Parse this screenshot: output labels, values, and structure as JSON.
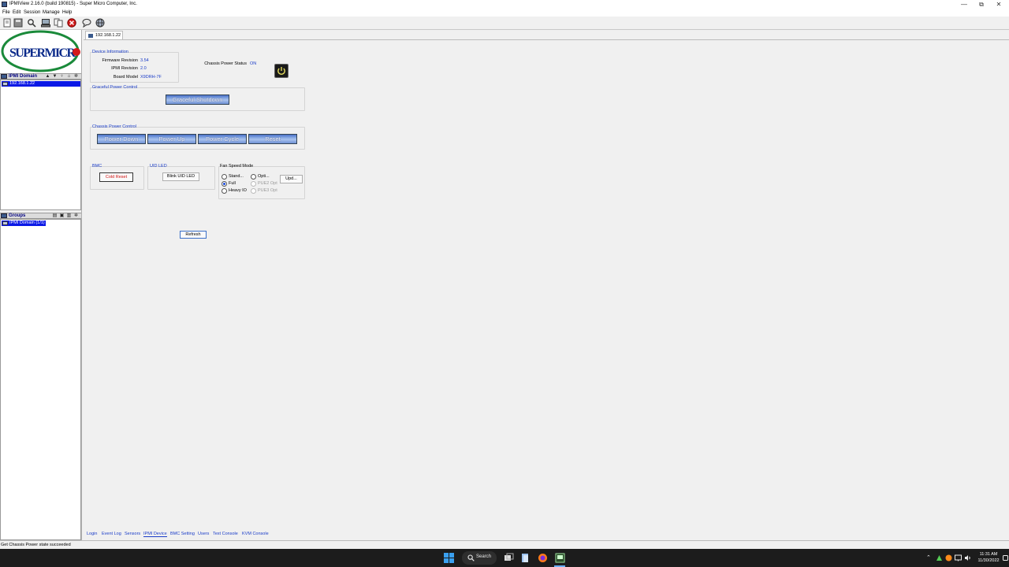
{
  "window": {
    "title": "IPMIView 2.16.0 (build 190815) - Super Micro Computer, Inc.",
    "minimize": "—",
    "maximize": "⧉",
    "close": "✕"
  },
  "menu": [
    "File",
    "Edit",
    "Session",
    "Manage",
    "Help"
  ],
  "toolbar_icons": [
    "new-icon",
    "save-icon",
    "search-icon",
    "computer-icon",
    "copy-icon",
    "disconnect-icon",
    "chat-icon",
    "globe-icon"
  ],
  "sidebar": {
    "logo_text": "SUPERMICR",
    "ipmi_header": "IPMI Domain",
    "ipmi_items": [
      "192.168.1.22"
    ],
    "groups_header": "Groups",
    "group_items": [
      "IPMI Domain (1/1)"
    ]
  },
  "tab": {
    "label": "192.168.1.22"
  },
  "device_info": {
    "title": "Device Information",
    "firmware_label": "Firmware Revision",
    "firmware_value": "3.54",
    "ipmi_label": "IPMI Revision",
    "ipmi_value": "2.0",
    "board_label": "Board Model",
    "board_value": "X9DRH-7F"
  },
  "chassis_status": {
    "label": "Chassis Power Status",
    "value": "ON"
  },
  "graceful": {
    "title": "Graceful Power Control",
    "shutdown_label": "Graceful Shutdown"
  },
  "chassis_control": {
    "title": "Chassis Power Control",
    "buttons": [
      "Power Down",
      "Power Up",
      "Power Cycle",
      "Reset"
    ]
  },
  "bmc": {
    "title": "BMC",
    "cold_reset_label": "Cold Reset"
  },
  "uid_led": {
    "title": "UID LED",
    "blink_label": "Blink UID LED"
  },
  "fan": {
    "title": "Fan Speed Mode",
    "standard": "Stand...",
    "full": "Full",
    "heavy_io": "Heavy IO",
    "optimal": "Opti...",
    "pue2": "PUE2 Opt",
    "pue3": "PUE3 Opt",
    "update_label": "Upd...",
    "selected": "Full"
  },
  "refresh_label": "Refresh",
  "bottom_tabs": [
    "Login",
    "Event Log",
    "Sensors",
    "IPMI Device",
    "BMC Setting",
    "Users",
    "Text Console",
    "KVM Console"
  ],
  "status_text": "Get Chassis Power state succeeded",
  "taskbar": {
    "search_label": "Search",
    "time": "11:31 AM",
    "date": "11/30/2022"
  }
}
